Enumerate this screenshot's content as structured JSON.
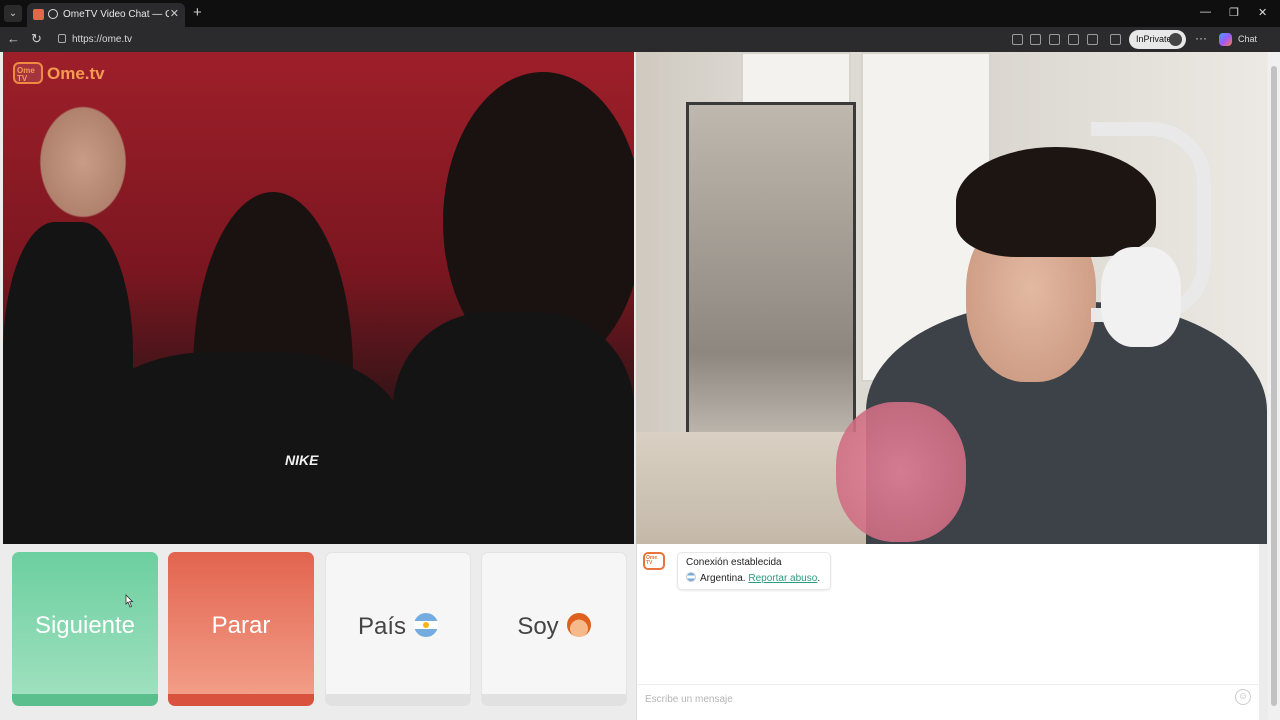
{
  "browser": {
    "tab_title": "OmeTV Video Chat — Omegle",
    "tab_close": "✕",
    "new_tab": "+",
    "url": "https://ome.tv",
    "inprivate_label": "InPrivate",
    "chat_label": "Chat",
    "more_label": "···",
    "window_controls": {
      "minimize": "—",
      "restore": "❐",
      "close": "✕"
    },
    "nav": {
      "back": "←",
      "refresh": "↻"
    }
  },
  "site": {
    "logo_box": "Ome TV",
    "logo_text": "Ome.tv"
  },
  "controls": {
    "next_label": "Siguiente",
    "stop_label": "Parar",
    "country_label": "País",
    "country_flag": "argentina-flag-icon",
    "me_label": "Soy",
    "me_icon": "boy-emoji-icon"
  },
  "chat": {
    "logo": "Ome TV",
    "system_message_title": "Conexión establecida",
    "country_name": "Argentina.",
    "report_link": "Reportar abuso",
    "report_suffix": ".",
    "input_placeholder": "Escribe un mensaje",
    "emoji_icon": "smiley-icon"
  },
  "colors": {
    "next_button": "#6ccf9f",
    "stop_button": "#e2644f",
    "brand_orange": "#f59a52",
    "link_green": "#2d9a7a"
  }
}
